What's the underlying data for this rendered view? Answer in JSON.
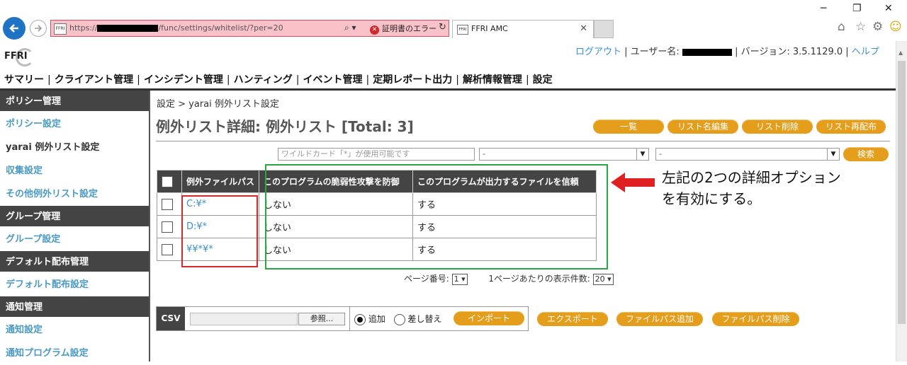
{
  "browser": {
    "url_prefix": "https://",
    "url_suffix": "/func/settings/whitelist/?per=20",
    "cert_error": "証明書のエラー",
    "tab_title": "FFRI AMC",
    "favicon_text": "FFRI"
  },
  "header": {
    "logo": "FFRI",
    "logout": "ログアウト",
    "user_label": "ユーザー名:",
    "version": "| バージョン: 3.5.1129.0 |",
    "help": "ヘルプ"
  },
  "nav": {
    "items": [
      "サマリー",
      "クライアント管理",
      "インシデント管理",
      "ハンティング",
      "イベント管理",
      "定期レポート出力",
      "解析情報管理",
      "設定"
    ]
  },
  "sidebar": {
    "sections": [
      {
        "title": "ポリシー管理",
        "links": [
          "ポリシー設定",
          "yarai 例外リスト設定",
          "収集設定",
          "その他例外リスト設定"
        ]
      },
      {
        "title": "グループ管理",
        "links": [
          "グループ設定"
        ]
      },
      {
        "title": "デフォルト配布管理",
        "links": [
          "デフォルト配布設定"
        ]
      },
      {
        "title": "通知管理",
        "links": [
          "通知設定",
          "通知プログラム設定"
        ]
      }
    ]
  },
  "main": {
    "breadcrumb": "設定 > yarai 例外リスト設定",
    "title": "例外リスト詳細: 例外リスト [Total: 3]",
    "buttons": {
      "list": "一覧",
      "rename": "リスト名編集",
      "delete": "リスト削除",
      "redeploy": "リスト再配布"
    },
    "search": {
      "placeholder": "ワイルドカード「*」が使用可能です",
      "select1": "-",
      "select2": "-",
      "button": "検索"
    },
    "table": {
      "headers": [
        "例外ファイルパス",
        "このプログラムの脆弱性攻撃を防御",
        "このプログラムが出力するファイルを信頼"
      ],
      "rows": [
        {
          "path": "C:¥*",
          "protect": "しない",
          "trust": "する"
        },
        {
          "path": "D:¥*",
          "protect": "しない",
          "trust": "する"
        },
        {
          "path": "¥¥*¥*",
          "protect": "しない",
          "trust": "する"
        }
      ]
    },
    "annotation": {
      "line1": "左記の2つの詳細オプション",
      "line2": "を有効にする。"
    },
    "pager": {
      "page_label": "ページ番号:",
      "page_value": "1",
      "per_label": "1ページあたりの表示件数:",
      "per_value": "20"
    },
    "csv": {
      "label": "CSV",
      "browse": "参照...",
      "add": "追加",
      "replace": "差し替え",
      "import": "インポート",
      "export": "エクスポート",
      "add_path": "ファイルパス追加",
      "delete_path": "ファイルパス削除"
    }
  },
  "colors": {
    "accent": "#e59e1c",
    "link": "#3a8fd0",
    "highlight_red": "#d62828",
    "highlight_green": "#2aa640"
  }
}
